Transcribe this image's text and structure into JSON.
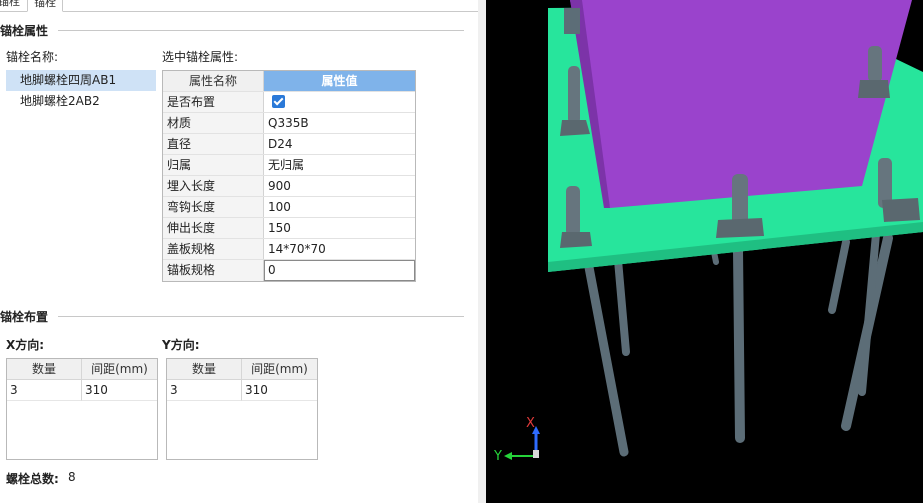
{
  "tabs": [
    {
      "label": "锚栓"
    },
    {
      "label": "锚栓"
    }
  ],
  "anchor_props": {
    "section_title": "锚栓属性",
    "name_label": "锚栓名称:",
    "list": [
      "地脚螺栓四周AB1",
      "地脚螺栓2AB2"
    ],
    "selected_label": "选中锚栓属性:",
    "grid_header": {
      "name": "属性名称",
      "value": "属性值"
    },
    "rows": [
      {
        "name": "是否布置",
        "value": ""
      },
      {
        "name": "材质",
        "value": "Q335B"
      },
      {
        "name": "直径",
        "value": "D24"
      },
      {
        "name": "归属",
        "value": "无归属"
      },
      {
        "name": "埋入长度",
        "value": "900"
      },
      {
        "name": "弯钩长度",
        "value": "100"
      },
      {
        "name": "伸出长度",
        "value": "150"
      },
      {
        "name": "盖板规格",
        "value": "14*70*70"
      },
      {
        "name": "锚板规格",
        "value": "0"
      }
    ]
  },
  "layout_section": {
    "section_title": "锚栓布置",
    "x_label": "X方向:",
    "y_label": "Y方向:",
    "x_grid": {
      "headers": [
        "数量",
        "间距(mm)"
      ],
      "rows": [
        [
          "3",
          "310"
        ]
      ]
    },
    "y_grid": {
      "headers": [
        "数量",
        "间距(mm)"
      ],
      "rows": [
        [
          "3",
          "310"
        ]
      ]
    },
    "total_label": "螺栓总数:",
    "total_value": "8"
  },
  "viewport": {
    "axis_y_label": "Y",
    "axis_x_label": "X",
    "colors": {
      "background": "#000000",
      "base_plate": "#27e59c",
      "column": "#9a43cc",
      "bolt": "#5d6e78",
      "accent": "#7fb3ea"
    }
  }
}
